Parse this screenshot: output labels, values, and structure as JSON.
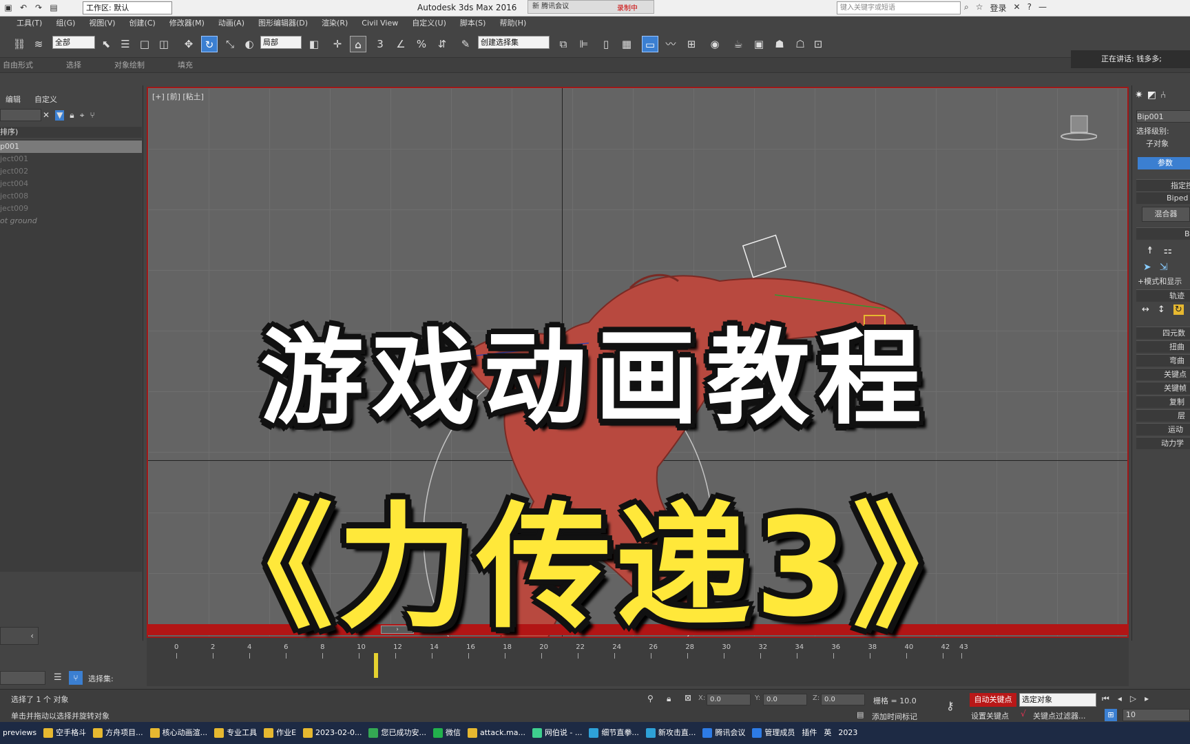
{
  "titlebar": {
    "workspace": "工作区: 默认",
    "app_title": "Autodesk 3ds Max 2016",
    "meeting_overlay": "新 腾讯会议",
    "recording": "录制中",
    "search_placeholder": "键入关键字或短语",
    "login": "登录"
  },
  "menu": [
    "工具(T)",
    "组(G)",
    "视图(V)",
    "创建(C)",
    "修改器(M)",
    "动画(A)",
    "图形编辑器(D)",
    "渲染(R)",
    "Civil View",
    "自定义(U)",
    "脚本(S)",
    "帮助(H)"
  ],
  "toolbar": {
    "filter": "全部",
    "coord_system": "局部",
    "named_selection": "创建选择集"
  },
  "ribbon": [
    "自由形式",
    "选择",
    "对象绘制",
    "填充"
  ],
  "speaking": "正在讲话: 钱多多;",
  "explorer": {
    "tab_edit": "编辑",
    "tab_custom": "自定义",
    "header": "排序)",
    "rows": [
      "p001",
      "ject001",
      "ject002",
      "ject004",
      "ject008",
      "ject009",
      "ot ground"
    ]
  },
  "viewport": {
    "label": "[+] [前] [粘土]"
  },
  "cmdpanel": {
    "object_name": "Bip001",
    "select_level": "选择级别:",
    "sub_object": "子对象",
    "params": "参数",
    "rollouts": [
      "指定控",
      "Biped 应",
      "混合器",
      "Bip",
      "+模式和显示",
      "轨迹",
      "四元数",
      "扭曲",
      "弯曲",
      "关键点",
      "关键帧",
      "复制",
      "层",
      "运动",
      "动力学"
    ]
  },
  "timeline": {
    "ticks": [
      "0",
      "2",
      "4",
      "6",
      "8",
      "10",
      "12",
      "14",
      "16",
      "18",
      "20",
      "22",
      "24",
      "26",
      "28",
      "30",
      "32",
      "34",
      "36",
      "38",
      "40",
      "42",
      "43"
    ],
    "selection_set": "选择集:"
  },
  "status": {
    "selected": "选择了 1 个 对象",
    "hint": "单击并拖动以选择并旋转对象",
    "x": "0.0",
    "y": "0.0",
    "z": "0.0",
    "grid": "栅格 = 10.0",
    "add_time_tag": "添加时间标记",
    "auto_key": "自动关键点",
    "set_key": "设置关键点",
    "key_filter": "关键点过滤器...",
    "selected_object": "选定对象",
    "frame": "10"
  },
  "taskbar": [
    "previews",
    "空手格斗",
    "方舟项目...",
    "核心动画渲...",
    "专业工具",
    "作业E",
    "2023-02-0...",
    "您已成功安...",
    "微信",
    "attack.ma...",
    "网伯说 - ...",
    "细节直拳...",
    "新攻击直...",
    "腾讯会议",
    "管理成员",
    "插件",
    "英",
    "2023"
  ],
  "overlay": {
    "title": "游戏动画教程",
    "subtitle": "《力传递3》"
  },
  "colors": {
    "accent_blue": "#3b7fd1",
    "viewport_border": "#a01818",
    "auto_key_red": "#b91818",
    "title_yellow": "#ffe83a"
  }
}
